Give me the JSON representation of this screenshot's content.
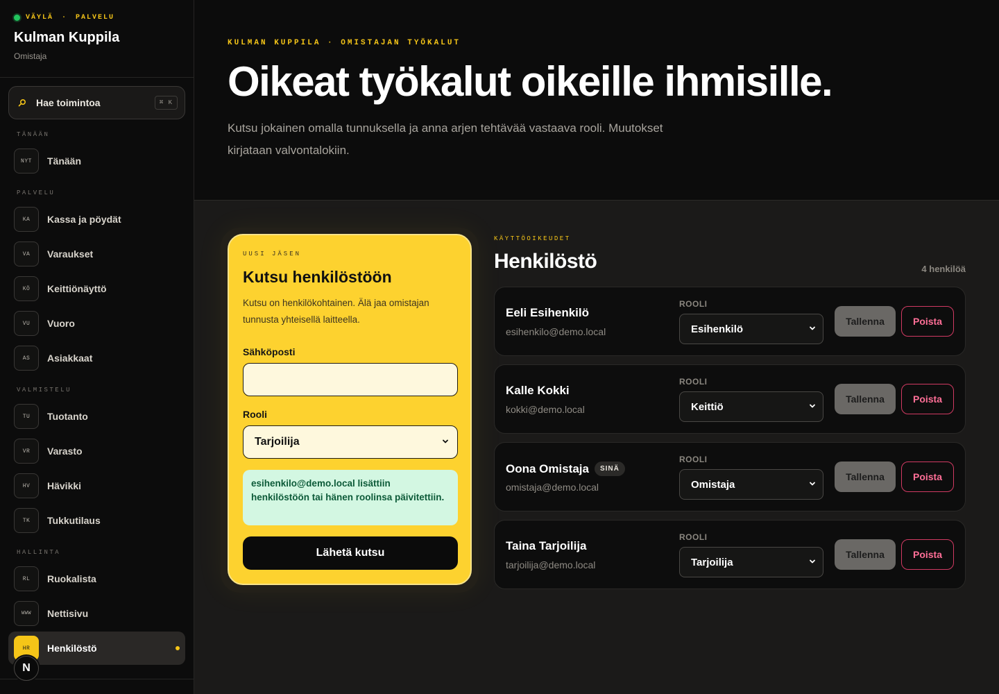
{
  "brand": {
    "eyebrow_left": "VÄYLÄ",
    "eyebrow_sep": "·",
    "eyebrow_right": "PALVELU",
    "name": "Kulman Kuppila",
    "role": "Omistaja"
  },
  "search": {
    "label": "Hae toimintoa",
    "shortcut": "⌘ K"
  },
  "nav": {
    "sections": [
      "TÄNÄÄN",
      "PALVELU",
      "VALMISTELU",
      "HALLINTA"
    ],
    "items": [
      {
        "badge": "NYT",
        "label": "Tänään"
      },
      {
        "badge": "KA",
        "label": "Kassa ja pöydät"
      },
      {
        "badge": "VA",
        "label": "Varaukset"
      },
      {
        "badge": "KÖ",
        "label": "Keittiönäyttö"
      },
      {
        "badge": "VU",
        "label": "Vuoro"
      },
      {
        "badge": "AS",
        "label": "Asiakkaat"
      },
      {
        "badge": "TU",
        "label": "Tuotanto"
      },
      {
        "badge": "VR",
        "label": "Varasto"
      },
      {
        "badge": "HV",
        "label": "Hävikki"
      },
      {
        "badge": "TK",
        "label": "Tukkutilaus"
      },
      {
        "badge": "RL",
        "label": "Ruokalista"
      },
      {
        "badge": "WWW",
        "label": "Nettisivu"
      },
      {
        "badge": "HR",
        "label": "Henkilöstö",
        "active": true
      }
    ],
    "floating_letter": "N"
  },
  "hero": {
    "eyebrow": "KULMAN KUPPILA · OMISTAJAN TYÖKALUT",
    "title": "Oikeat työkalut oikeille ihmisille.",
    "description": "Kutsu jokainen omalla tunnuksella ja anna arjen tehtävää vastaava rooli. Muutokset kirjataan valvontalokiin."
  },
  "invite": {
    "eyebrow": "UUSI JÄSEN",
    "title": "Kutsu henkilöstöön",
    "description": "Kutsu on henkilökohtainen. Älä jaa omistajan tunnusta yhteisellä laitteella.",
    "email_label": "Sähköposti",
    "email_value": "",
    "role_label": "Rooli",
    "role_value": "Tarjoilija",
    "success": "esihenkilo@demo.local lisättiin henkilöstöön tai hänen roolinsa päivitettiin.",
    "submit": "Lähetä kutsu"
  },
  "staff": {
    "eyebrow": "KÄYTTÖOIKEUDET",
    "title": "Henkilöstö",
    "count": "4 henkilöä",
    "role_heading": "ROOLI",
    "save_label": "Tallenna",
    "delete_label": "Poista",
    "you_label": "SINÄ",
    "members": [
      {
        "name": "Eeli Esihenkilö",
        "email": "esihenkilo@demo.local",
        "role": "Esihenkilö"
      },
      {
        "name": "Kalle Kokki",
        "email": "kokki@demo.local",
        "role": "Keittiö"
      },
      {
        "name": "Oona Omistaja",
        "email": "omistaja@demo.local",
        "role": "Omistaja",
        "is_you": true
      },
      {
        "name": "Taina Tarjoilija",
        "email": "tarjoilija@demo.local",
        "role": "Tarjoilija"
      }
    ]
  }
}
